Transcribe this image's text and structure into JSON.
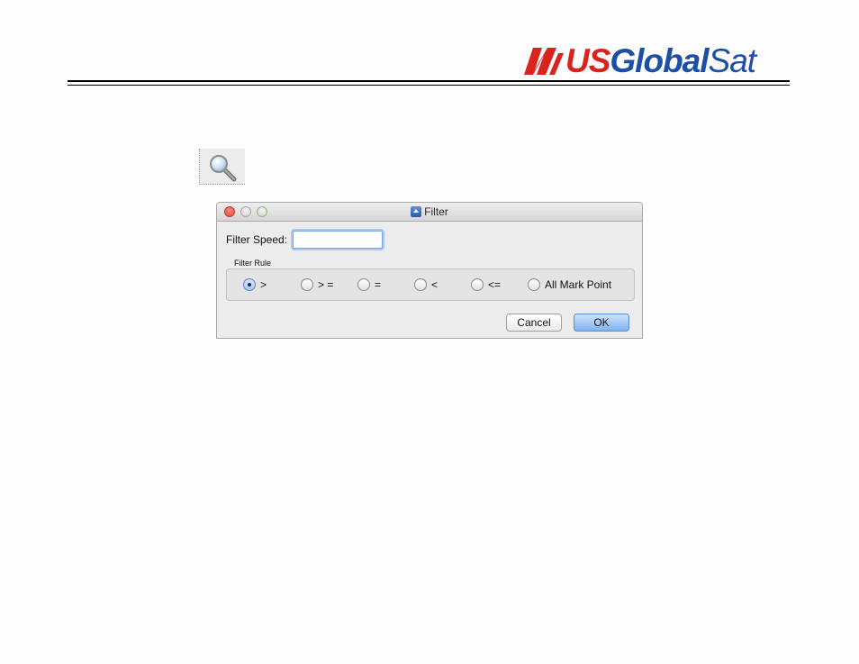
{
  "logo": {
    "us": "US",
    "global": "Global",
    "sat": "Sat",
    "brand_red": "#d8231f",
    "brand_blue": "#1d4fa3"
  },
  "toolbar": {
    "search_icon": "magnifier-icon"
  },
  "dialog": {
    "title": "Filter",
    "filter_speed_label": "Filter Speed:",
    "filter_speed_value": "",
    "filter_rule_label": "Filter Rule",
    "options": [
      {
        "label": ">",
        "checked": true
      },
      {
        "label": "> =",
        "checked": false
      },
      {
        "label": "=",
        "checked": false
      },
      {
        "label": "<",
        "checked": false
      },
      {
        "label": "<=",
        "checked": false
      },
      {
        "label": "All Mark Point",
        "checked": false
      }
    ],
    "cancel_label": "Cancel",
    "ok_label": "OK"
  }
}
